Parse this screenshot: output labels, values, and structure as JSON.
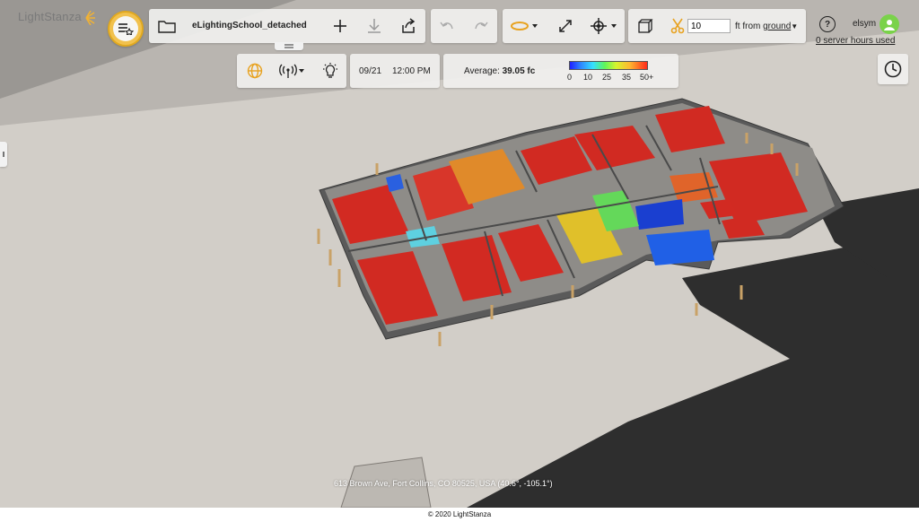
{
  "app": {
    "logo_text": "LightStanza"
  },
  "toolbar": {
    "file_name": "eLightingSchool_detached",
    "cut_height_value": "10",
    "cut_unit_prefix": "ft from",
    "cut_reference": "ground",
    "help_label": "?",
    "username": "elsym",
    "server_hours_link": "0 server hours used"
  },
  "subbar": {
    "date": "09/21",
    "time": "12:00 PM",
    "average_label": "Average:",
    "average_value": "39.05 fc",
    "legend_ticks": [
      "0",
      "10",
      "25",
      "35",
      "50+"
    ],
    "legend_colors": [
      "#1f1fff",
      "#2f8cff",
      "#35e0ff",
      "#5ef55a",
      "#d7f52e",
      "#ffb52f",
      "#ff2a1a"
    ]
  },
  "map": {
    "address": "613 Brown Ave, Fort Collins, CO 80525, USA (40.6°, -105.1°)"
  },
  "footer": {
    "copyright": "© 2020 LightStanza"
  },
  "icons": [
    "menu-star-icon",
    "folder-icon",
    "plus-icon",
    "download-icon",
    "share-icon",
    "undo-icon",
    "redo-icon",
    "orbit-icon",
    "expand-icon",
    "target-icon",
    "cube-icon",
    "scissors-icon",
    "help-icon",
    "user-avatar-icon",
    "globe-icon",
    "antenna-icon",
    "bulb-icon",
    "clock-icon",
    "grip-icon"
  ]
}
